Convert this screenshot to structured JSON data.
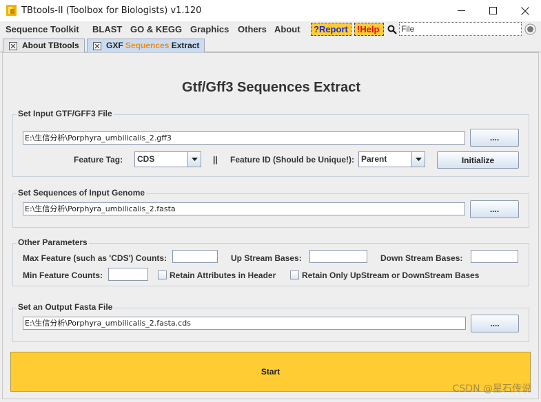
{
  "window": {
    "title": "TBtools-II (Toolbox for Biologists) v1.120"
  },
  "menu": {
    "items": [
      "Sequence Toolkit",
      "BLAST",
      "GO & KEGG",
      "Graphics",
      "Others",
      "About"
    ],
    "report_label": "?Report",
    "help_label": "!Help",
    "search_value": "File"
  },
  "tabs": {
    "about": "About TBtools",
    "extract_prefix": "GXF",
    "extract_highlight": "Sequences",
    "extract_suffix": "Extract"
  },
  "main": {
    "heading": "Gtf/Gff3 Sequences Extract",
    "input_gtf": {
      "title": "Set Input GTF/GFF3 File",
      "path": "E:\\生信分析\\Porphyra_umbilicalis_2.gff3",
      "browse_label": "....",
      "feature_tag_label": "Feature Tag:",
      "feature_tag_value": "CDS",
      "separator": "||",
      "feature_id_label": "Feature ID (Should be Unique!):",
      "feature_id_value": "Parent",
      "initialize_label": "Initialize"
    },
    "genome": {
      "title": "Set Sequences of Input Genome",
      "path": "E:\\生信分析\\Porphyra_umbilicalis_2.fasta",
      "browse_label": "...."
    },
    "other": {
      "title": "Other Parameters",
      "max_feature_label": "Max Feature (such as 'CDS') Counts:",
      "max_feature_value": "",
      "upstream_label": "Up Stream Bases:",
      "upstream_value": "",
      "downstream_label": "Down Stream Bases:",
      "downstream_value": "",
      "min_feature_label": "Min Feature Counts:",
      "min_feature_value": "",
      "retain_attr_label": "Retain Attributes in Header",
      "retain_only_label": "Retain Only UpStream or DownStream Bases"
    },
    "output": {
      "title": "Set an Output Fasta File",
      "path": "E:\\生信分析\\Porphyra_umbilicalis_2.fasta.cds",
      "browse_label": "...."
    },
    "start_label": "Start"
  },
  "watermark": "CSDN @星石传说",
  "colors": {
    "accent_yellow": "#ffcc33",
    "report_blue": "#1a2fd6",
    "help_red": "#e01010",
    "tab_active": "#c9dcf3",
    "tab_orange": "#f28c10"
  }
}
